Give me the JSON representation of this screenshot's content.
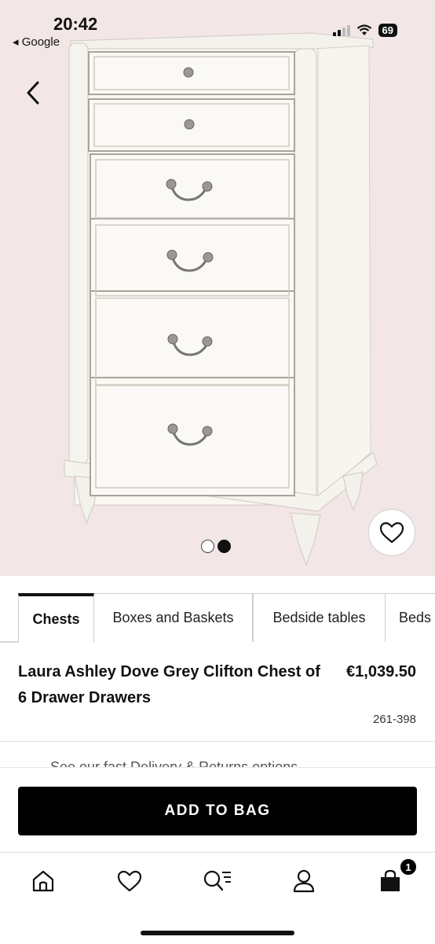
{
  "status_bar": {
    "time": "20:42",
    "back_app": "◂ Google",
    "battery": "69"
  },
  "hero": {
    "image_alt": "chest-of-drawers-photo",
    "carousel": {
      "total": 2,
      "active": 2
    }
  },
  "tabs": [
    {
      "label": "Chests",
      "active": true
    },
    {
      "label": "Boxes and Baskets",
      "active": false
    },
    {
      "label": "Bedside tables",
      "active": false
    },
    {
      "label": "Beds",
      "active": false
    }
  ],
  "product": {
    "title": "Laura Ashley Dove Grey Clifton Chest of 6 Drawer Drawers",
    "price": "€1,039.50",
    "code": "261-398"
  },
  "delivery": {
    "text": "See our fast Delivery & Returns options"
  },
  "actions": {
    "add_to_bag": "ADD TO BAG"
  },
  "bottom_nav": {
    "items": [
      "home-icon",
      "heart-icon",
      "search-list-icon",
      "account-icon",
      "bag-icon"
    ],
    "bag_count": "1"
  },
  "colors": {
    "hero_bg": "#f3e6e7",
    "primary": "#000000"
  }
}
